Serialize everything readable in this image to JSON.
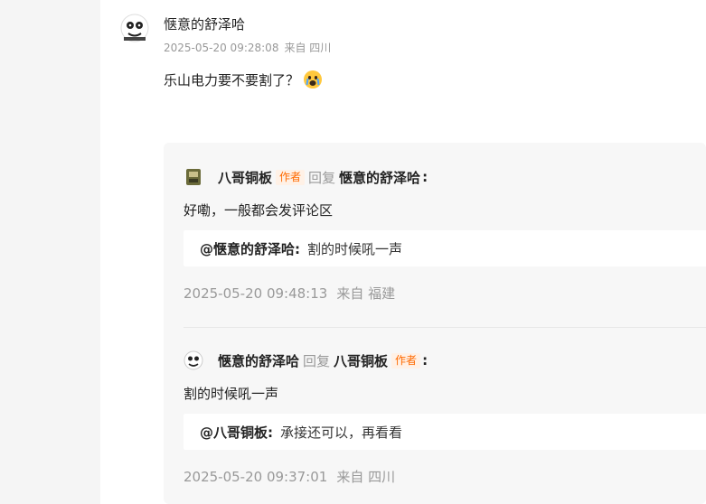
{
  "main_comment": {
    "user": "惬意的舒泽哈",
    "date": "2025-05-20 09:28:08",
    "source": "来自 四川",
    "text": "乐山电力要不要割了？",
    "emoji": "crying-face-emoji"
  },
  "replies": [
    {
      "user": "八哥铜板",
      "author_tag": "作者",
      "reply_word": "回复",
      "reply_to": "惬意的舒泽哈",
      "colon": ":",
      "text": "好嘞，一般都会发评论区",
      "quote_user": "@惬意的舒泽哈:",
      "quote_text": "割的时候吼一声",
      "date": "2025-05-20 09:48:13",
      "source": "来自 福建"
    },
    {
      "user": "惬意的舒泽哈",
      "reply_word": "回复",
      "reply_to": "八哥铜板",
      "reply_to_tag": "作者",
      "colon": ":",
      "text": "割的时候吼一声",
      "quote_user": "@八哥铜板:",
      "quote_text": "承接还可以，再看看",
      "date": "2025-05-20 09:37:01",
      "source": "来自 四川"
    }
  ],
  "colors": {
    "author_tag": "#ff6a00",
    "author_tag_bg": "#fff1e6",
    "meta_gray": "#999999"
  }
}
